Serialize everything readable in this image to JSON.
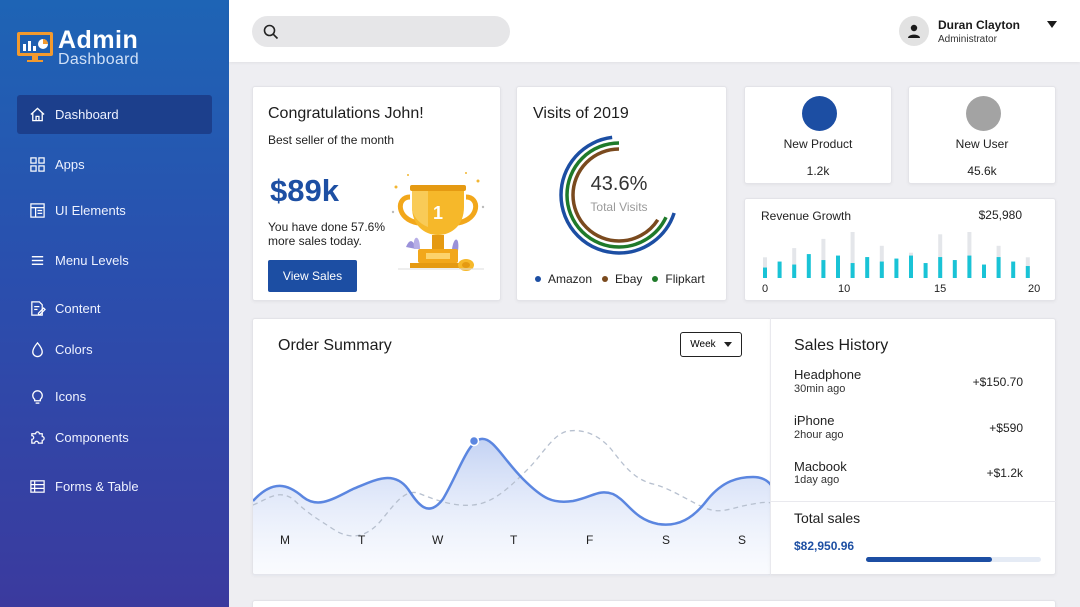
{
  "brand": {
    "title": "Admin",
    "subtitle": "Dashboard"
  },
  "sidebar": {
    "items": [
      {
        "label": "Dashboard",
        "icon": "home-icon"
      },
      {
        "label": "Apps",
        "icon": "grid-icon"
      },
      {
        "label": "UI Elements",
        "icon": "layout-icon"
      },
      {
        "label": "Menu Levels",
        "icon": "menu-icon"
      },
      {
        "label": "Content",
        "icon": "document-edit-icon"
      },
      {
        "label": "Colors",
        "icon": "drop-icon"
      },
      {
        "label": "Icons",
        "icon": "lightbulb-icon"
      },
      {
        "label": "Components",
        "icon": "puzzle-icon"
      },
      {
        "label": "Forms & Table",
        "icon": "table-icon"
      }
    ]
  },
  "search": {
    "placeholder": ""
  },
  "user": {
    "name": "Duran Clayton",
    "role": "Administrator"
  },
  "congrats": {
    "title": "Congratulations John!",
    "subtitle": "Best seller of the month",
    "amount": "$89k",
    "description": "You have done 57.6% more sales today.",
    "button": "View Sales"
  },
  "visits": {
    "title": "Visits of 2019",
    "percent": "43.6%",
    "percent_label": "Total Visits",
    "legend": [
      {
        "label": "Amazon",
        "color": "#1c4ea3"
      },
      {
        "label": "Ebay",
        "color": "#7a4a1e"
      },
      {
        "label": "Flipkart",
        "color": "#1f7a2a"
      }
    ],
    "rings": [
      {
        "color": "#1c4ea3",
        "fraction": 0.68
      },
      {
        "color": "#1f7a2a",
        "fraction": 0.68
      },
      {
        "color": "#7a4a1e",
        "fraction": 0.68
      }
    ]
  },
  "stats": [
    {
      "label": "New Product",
      "value": "1.2k",
      "color": "#1c4ea3"
    },
    {
      "label": "New User",
      "value": "45.6k",
      "color": "#a3a3a3"
    }
  ],
  "revenue": {
    "title": "Revenue Growth",
    "value": "$25,980",
    "ticks": [
      "0",
      "10",
      "15",
      "20"
    ],
    "bars": [
      0.35,
      0.55,
      0.45,
      0.8,
      0.6,
      0.75,
      0.5,
      0.7,
      0.55,
      0.65,
      0.75,
      0.5,
      0.7,
      0.6,
      0.75,
      0.45,
      0.7,
      0.55,
      0.4
    ],
    "bars_bg": [
      0.45,
      0.0,
      0.65,
      0.0,
      0.85,
      0.0,
      1.0,
      0.0,
      0.7,
      0.0,
      0.55,
      0.0,
      0.95,
      0.0,
      1.0,
      0.0,
      0.7,
      0.0,
      0.45
    ]
  },
  "order": {
    "title": "Order Summary",
    "period": "Week",
    "days": [
      "M",
      "T",
      "W",
      "T",
      "F",
      "S",
      "S"
    ]
  },
  "sales_history": {
    "title": "Sales History",
    "items": [
      {
        "name": "Headphone",
        "time": "30min ago",
        "amount": "+$150.70"
      },
      {
        "name": "iPhone",
        "time": "2hour ago",
        "amount": "+$590"
      },
      {
        "name": "Macbook",
        "time": "1day ago",
        "amount": "+$1.2k"
      }
    ],
    "total_label": "Total sales",
    "total_value": "$82,950.96",
    "progress": 0.72
  }
}
